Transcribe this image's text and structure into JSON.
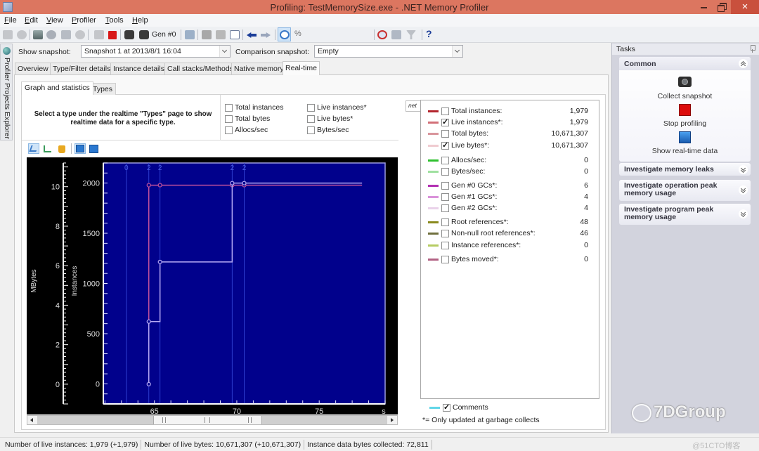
{
  "window": {
    "title": "Profiling: TestMemorySize.exe - .NET Memory Profiler"
  },
  "menu": [
    "File",
    "Edit",
    "View",
    "Profiler",
    "Tools",
    "Help"
  ],
  "toolbar": {
    "gen_label": "Gen #0",
    "percent_label": "%",
    "view_mode": "Standard",
    "help_label": "?"
  },
  "side_panel": {
    "label": "Profiler Projects Explorer"
  },
  "snapshot_bar": {
    "show_label": "Show snapshot:",
    "show_value": "Snapshot 1 at 2013/8/1 16:04",
    "comparison_label": "Comparison snapshot:",
    "comparison_value": "Empty"
  },
  "tabs": [
    {
      "label": "Overview",
      "active": false
    },
    {
      "label": "Type/Filter details",
      "active": false
    },
    {
      "label": "Instance details",
      "active": false
    },
    {
      "label": "Call stacks/Methods",
      "active": false
    },
    {
      "label": "Native memory",
      "active": false
    },
    {
      "label": "Real-time",
      "active": true
    }
  ],
  "subtabs": [
    {
      "label": "Graph and statistics",
      "active": true
    },
    {
      "label": "Types",
      "active": false
    }
  ],
  "type_hint": "Select a type under the realtime \"Types\" page to show realtime data for a specific type.",
  "type_checkboxes": [
    {
      "label": "Total instances",
      "checked": false
    },
    {
      "label": "Live instances*",
      "checked": false
    },
    {
      "label": "Total bytes",
      "checked": false
    },
    {
      "label": "Live bytes*",
      "checked": false
    },
    {
      "label": "Allocs/sec",
      "checked": false
    },
    {
      "label": "Bytes/sec",
      "checked": false
    }
  ],
  "chart_data": {
    "type": "line",
    "title": "",
    "x_axis": {
      "label": "s",
      "range": [
        61.9,
        79.0
      ],
      "ticks": [
        65,
        70,
        75
      ],
      "minor_step": 1
    },
    "y_axes": [
      {
        "label": "MBytes",
        "range": [
          -1.0,
          11.2
        ],
        "ticks": [
          0,
          2,
          4,
          6,
          8,
          10
        ],
        "minor_step": 0.2
      },
      {
        "label": "Instances",
        "range": [
          -200,
          2200
        ],
        "ticks": [
          0,
          500,
          1000,
          1500,
          2000
        ],
        "minor_step": 100
      }
    ],
    "grid": false,
    "gc_markers": [
      {
        "time": 63.3,
        "generation": "0"
      },
      {
        "time": 64.66,
        "generation": "2"
      },
      {
        "time": 65.34,
        "generation": "2"
      },
      {
        "time": 69.72,
        "generation": "2"
      },
      {
        "time": 70.45,
        "generation": "2"
      }
    ],
    "series": [
      {
        "name": "Live instances*",
        "axis": "Instances",
        "color": "#c4529c",
        "points": [
          [
            64.66,
            0
          ],
          [
            64.66,
            1979
          ],
          [
            65.34,
            1979
          ],
          [
            69.72,
            1979
          ],
          [
            70.45,
            1979
          ],
          [
            77.6,
            1979
          ]
        ],
        "markers": [
          [
            64.66,
            1979
          ],
          [
            65.34,
            1979
          ],
          [
            69.72,
            1979
          ],
          [
            70.45,
            1979
          ]
        ]
      },
      {
        "name": "Live bytes*",
        "axis": "MBytes",
        "color": "#b6aaf4",
        "points": [
          [
            64.66,
            0
          ],
          [
            64.66,
            3.17
          ],
          [
            65.34,
            3.17
          ],
          [
            65.34,
            6.19
          ],
          [
            69.72,
            6.19
          ],
          [
            69.72,
            10.18
          ],
          [
            70.45,
            10.18
          ],
          [
            77.6,
            10.18
          ]
        ],
        "markers": [
          [
            64.66,
            0
          ],
          [
            64.66,
            3.17
          ],
          [
            65.34,
            6.19
          ],
          [
            69.72,
            10.18
          ],
          [
            70.45,
            10.18
          ]
        ]
      }
    ]
  },
  "stats": {
    "tab_label": "net",
    "rows": [
      {
        "label": "Total instances:",
        "value": "1,979",
        "checked": false,
        "color": "#b3262e"
      },
      {
        "label": "Live instances*:",
        "value": "1,979",
        "checked": true,
        "color": "#d27078"
      },
      {
        "label": "Total bytes:",
        "value": "10,671,307",
        "checked": false,
        "color": "#d9959c"
      },
      {
        "label": "Live bytes*:",
        "value": "10,671,307",
        "checked": true,
        "color": "#f0cbd0"
      },
      {
        "label": "Allocs/sec:",
        "value": "0",
        "checked": false,
        "color": "#2fc02f"
      },
      {
        "label": "Bytes/sec:",
        "value": "0",
        "checked": false,
        "color": "#9fe0a0"
      },
      {
        "label": "Gen #0 GCs*:",
        "value": "6",
        "checked": false,
        "color": "#b22fb2"
      },
      {
        "label": "Gen #1 GCs*:",
        "value": "4",
        "checked": false,
        "color": "#da92da"
      },
      {
        "label": "Gen #2 GCs*:",
        "value": "4",
        "checked": false,
        "color": "#ead2ea"
      },
      {
        "label": "Root references*:",
        "value": "48",
        "checked": false,
        "color": "#8a8a1e"
      },
      {
        "label": "Non-null root references*:",
        "value": "46",
        "checked": false,
        "color": "#70703e"
      },
      {
        "label": "Instance references*:",
        "value": "0",
        "checked": false,
        "color": "#b6cc62"
      },
      {
        "label": "Bytes moved*:",
        "value": "0",
        "checked": false,
        "color": "#b26284"
      }
    ],
    "comments": {
      "label": "Comments",
      "checked": true,
      "color": "#62d6e8"
    },
    "footnote": "*= Only updated at garbage collects"
  },
  "tasks": {
    "title": "Tasks",
    "common": {
      "title": "Common",
      "items": [
        "Collect snapshot",
        "Stop profiling",
        "Show real-time data"
      ]
    },
    "sections": [
      "Investigate memory leaks",
      "Investigate operation peak memory usage",
      "Investigate program peak memory usage"
    ]
  },
  "status_bar": [
    "Number of live instances: 1,979 (+1,979)",
    "Number of live bytes: 10,671,307 (+10,671,307)",
    "Instance data bytes collected: 72,811"
  ],
  "watermark": {
    "brand": "7DGroup",
    "site": "@51CTO博客"
  }
}
